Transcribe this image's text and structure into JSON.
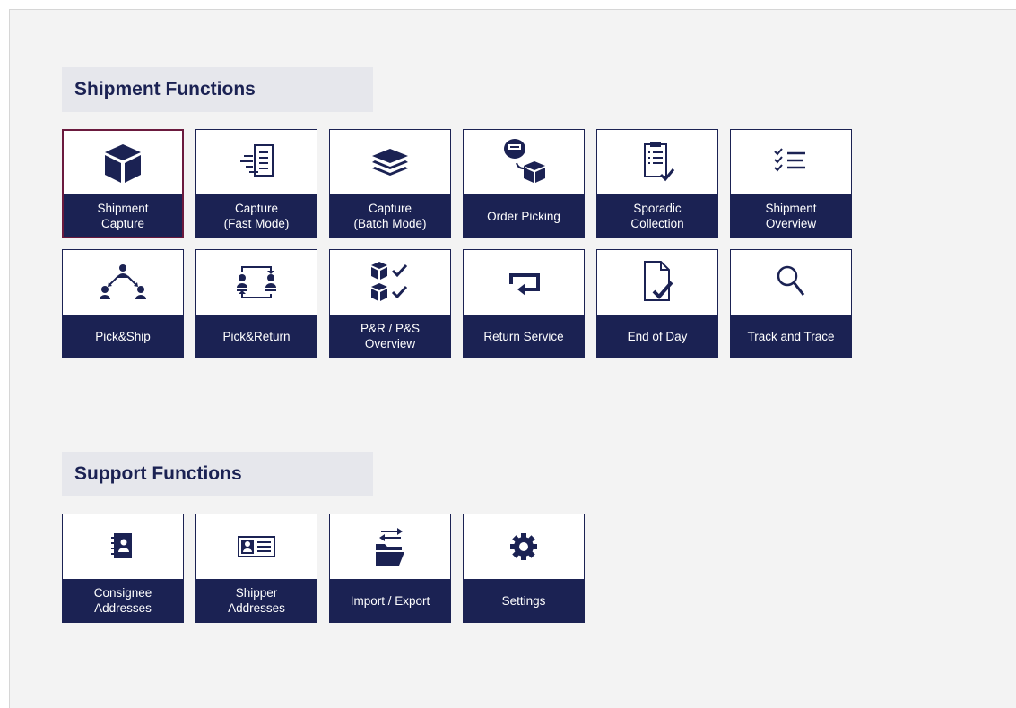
{
  "shipment_section": {
    "title": "Shipment Functions",
    "tiles": [
      {
        "id": "shipment-capture",
        "label": "Shipment\nCapture",
        "icon": "box-icon",
        "selected": true
      },
      {
        "id": "capture-fast-mode",
        "label": "Capture\n(Fast Mode)",
        "icon": "fast-document-icon"
      },
      {
        "id": "capture-batch-mode",
        "label": "Capture\n(Batch Mode)",
        "icon": "layers-icon"
      },
      {
        "id": "order-picking",
        "label": "Order Picking",
        "icon": "tray-to-box-icon"
      },
      {
        "id": "sporadic-collection",
        "label": "Sporadic\nCollection",
        "icon": "clipboard-check-icon"
      },
      {
        "id": "shipment-overview",
        "label": "Shipment\nOverview",
        "icon": "checklist-icon"
      },
      {
        "id": "pick-and-ship",
        "label": "Pick&Ship",
        "icon": "people-network-icon"
      },
      {
        "id": "pick-and-return",
        "label": "Pick&Return",
        "icon": "people-exchange-icon"
      },
      {
        "id": "pr-ps-overview",
        "label": "P&R / P&S\nOverview",
        "icon": "boxes-check-icon"
      },
      {
        "id": "return-service",
        "label": "Return Service",
        "icon": "return-arrow-icon"
      },
      {
        "id": "end-of-day",
        "label": "End of Day",
        "icon": "document-check-icon"
      },
      {
        "id": "track-and-trace",
        "label": "Track and Trace",
        "icon": "magnifier-icon"
      }
    ]
  },
  "support_section": {
    "title": "Support Functions",
    "tiles": [
      {
        "id": "consignee-addresses",
        "label": "Consignee\nAddresses",
        "icon": "address-book-icon"
      },
      {
        "id": "shipper-addresses",
        "label": "Shipper\nAddresses",
        "icon": "id-card-icon"
      },
      {
        "id": "import-export",
        "label": "Import / Export",
        "icon": "folder-transfer-icon"
      },
      {
        "id": "settings",
        "label": "Settings",
        "icon": "gear-icon"
      }
    ]
  },
  "colors": {
    "navy": "#1b2253",
    "selected_border": "#6b1a3e",
    "section_header_bg": "#e6e7ec",
    "page_bg": "#f3f3f3"
  }
}
